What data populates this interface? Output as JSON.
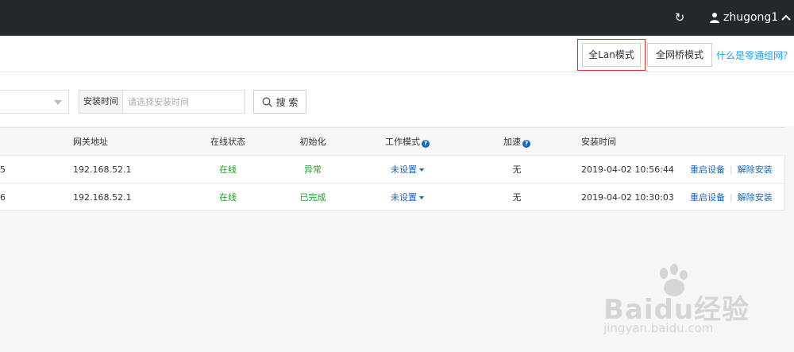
{
  "header": {
    "refresh_icon": "refresh-icon",
    "username": "zhugong1"
  },
  "mode_bar": {
    "lan_mode_label": "全Lan模式",
    "bridge_mode_label": "全网桥模式",
    "help_link": "什么是零通组网？"
  },
  "filters": {
    "install_time_label": "安装时间",
    "install_time_placeholder": "请选择安装时间",
    "search_label": "搜 索"
  },
  "table": {
    "headers": {
      "gateway": "网关地址",
      "status": "在线状态",
      "init": "初始化",
      "work_mode": "工作模式",
      "accel": "加速",
      "install_time": "安装时间"
    },
    "rows": [
      {
        "idx": "5",
        "gateway": "192.168.52.1",
        "status": "在线",
        "init": "异常",
        "work_mode": "未设置",
        "accel": "无",
        "install_time": "2019-04-02 10:56:44",
        "restart": "重启设备",
        "uninstall": "解除安装"
      },
      {
        "idx": "6",
        "gateway": "192.168.52.1",
        "status": "在线",
        "init": "已完成",
        "work_mode": "未设置",
        "accel": "无",
        "install_time": "2019-04-02 10:30:03",
        "restart": "重启设备",
        "uninstall": "解除安装"
      }
    ]
  },
  "watermark": {
    "brand": "Baidu经验",
    "url": "jingyan.baidu.com"
  },
  "colors": {
    "topbar": "#23282d",
    "link_blue": "#1565c0",
    "status_green": "#22a022",
    "highlight_red": "#e02e2e",
    "help_blue": "#1e9ff2"
  }
}
